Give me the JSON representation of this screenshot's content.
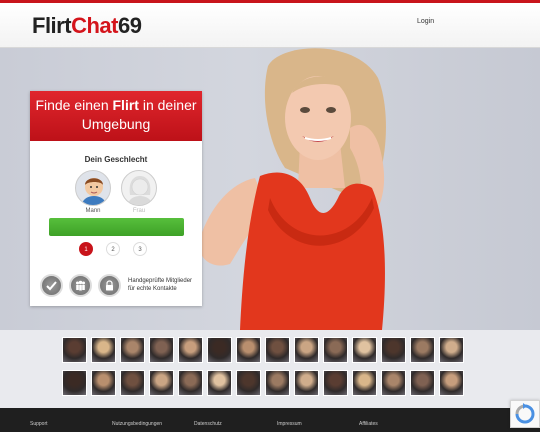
{
  "header": {
    "logo": {
      "part1": "Flirt",
      "part2": "Chat",
      "part3": "69"
    },
    "login_label": "Login"
  },
  "card": {
    "headline_pre": "Finde einen ",
    "headline_bold": "Flirt",
    "headline_post": " in deiner Umgebung",
    "gender_title": "Dein Geschlecht",
    "gender_male": "Mann",
    "gender_female": "Frau",
    "steps": [
      "1",
      "2",
      "3"
    ],
    "badges_text": "Handgeprüfte Mitglieder für echte Kontakte"
  },
  "footer": {
    "links": [
      "Support",
      "Nutzungsbedingungen",
      "Datenschutz",
      "Impressum",
      "Affiliates"
    ]
  },
  "colors": {
    "brand_red": "#c8141b",
    "cta_green": "#4bb131",
    "footer_bg": "#1f1f1f"
  }
}
